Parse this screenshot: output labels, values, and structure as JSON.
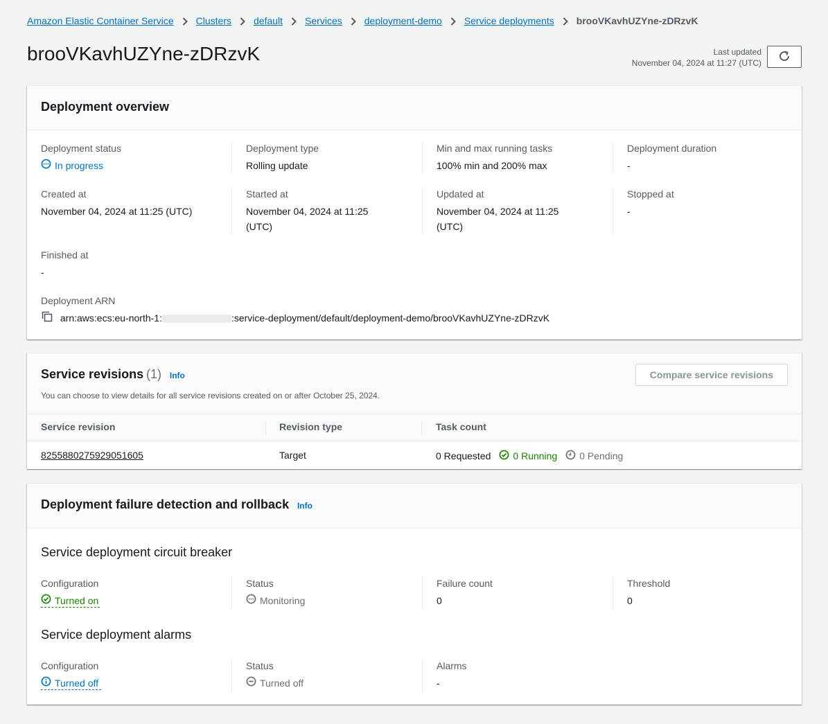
{
  "breadcrumb": {
    "items": [
      "Amazon Elastic Container Service",
      "Clusters",
      "default",
      "Services",
      "deployment-demo",
      "Service deployments"
    ],
    "current": "brooVKavhUZYne-zDRzvK"
  },
  "page": {
    "title": "brooVKavhUZYne-zDRzvK",
    "last_updated_label": "Last updated",
    "last_updated_value": "November 04, 2024 at 11:27 (UTC)"
  },
  "overview": {
    "title": "Deployment overview",
    "deployment_status_label": "Deployment status",
    "deployment_status_value": "In progress",
    "deployment_type_label": "Deployment type",
    "deployment_type_value": "Rolling update",
    "min_max_label": "Min and max running tasks",
    "min_max_value": "100% min and 200% max",
    "duration_label": "Deployment duration",
    "duration_value": "-",
    "created_label": "Created at",
    "created_value": "November 04, 2024 at 11:25 (UTC)",
    "started_label": "Started at",
    "started_value_1": "November 04, 2024 at 11:25",
    "started_value_2": "(UTC)",
    "updated_label": "Updated at",
    "updated_value_1": "November 04, 2024 at 11:25",
    "updated_value_2": "(UTC)",
    "stopped_label": "Stopped at",
    "stopped_value": "-",
    "finished_label": "Finished at",
    "finished_value": "-",
    "arn_label": "Deployment ARN",
    "arn_prefix": "arn:aws:ecs:eu-north-1:",
    "arn_suffix": ":service-deployment/default/deployment-demo/brooVKavhUZYne-zDRzvK"
  },
  "revisions": {
    "title": "Service revisions",
    "count": "(1)",
    "info": "Info",
    "description": "You can choose to view details for all service revisions created on or after October 25, 2024.",
    "compare_button": "Compare service revisions",
    "columns": [
      "Service revision",
      "Revision type",
      "Task count"
    ],
    "rows": [
      {
        "revision": "8255880275929051605",
        "type": "Target",
        "requested": "0 Requested",
        "running": "0 Running",
        "pending": "0 Pending"
      }
    ]
  },
  "rollback": {
    "title": "Deployment failure detection and rollback",
    "info": "Info",
    "circuit_title": "Service deployment circuit breaker",
    "cb_config_label": "Configuration",
    "cb_config_value": "Turned on",
    "cb_status_label": "Status",
    "cb_status_value": "Monitoring",
    "cb_failure_label": "Failure count",
    "cb_failure_value": "0",
    "cb_threshold_label": "Threshold",
    "cb_threshold_value": "0",
    "alarms_title": "Service deployment alarms",
    "al_config_label": "Configuration",
    "al_config_value": "Turned off",
    "al_status_label": "Status",
    "al_status_value": "Turned off",
    "al_alarms_label": "Alarms",
    "al_alarms_value": "-"
  },
  "colors": {
    "link": "#0073bb",
    "success": "#1d8102",
    "muted": "#687078"
  }
}
